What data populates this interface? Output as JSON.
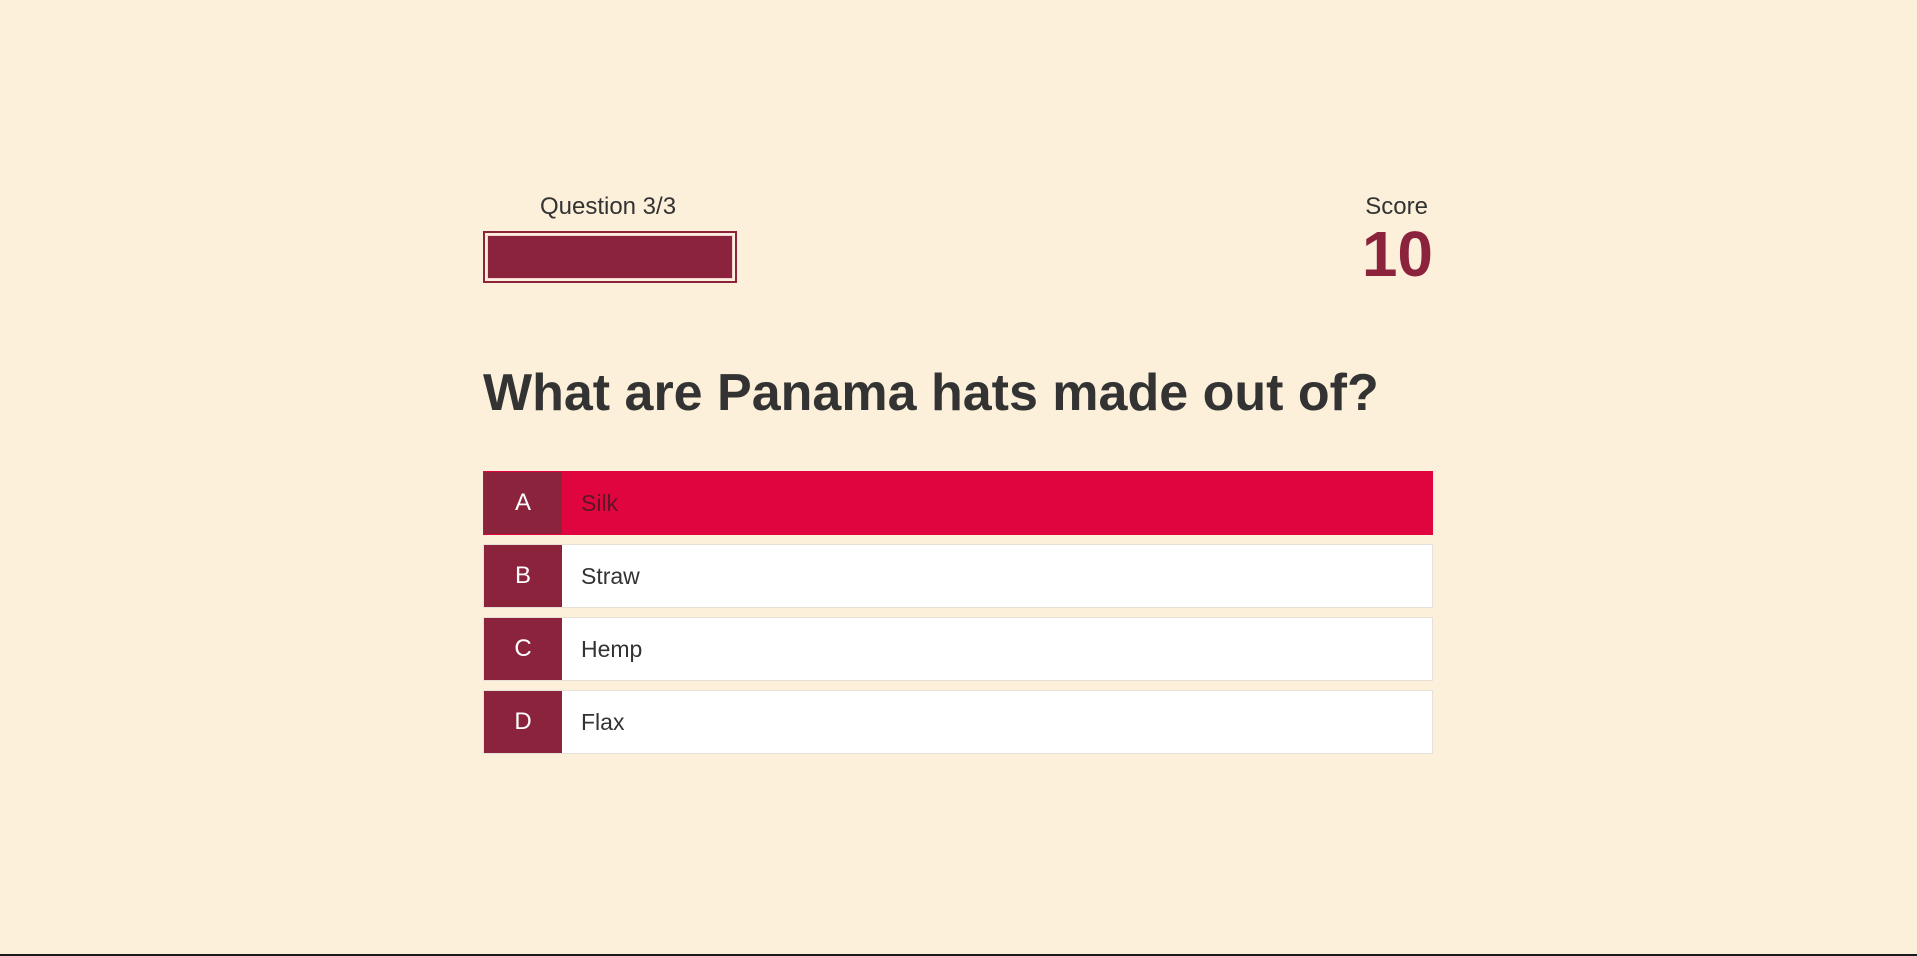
{
  "hud": {
    "question_counter": "Question 3/3",
    "progress": 1.0,
    "score_label": "Score",
    "score_value": "10"
  },
  "question": {
    "text": "What are Panama hats made out of?"
  },
  "choices": [
    {
      "prefix": "A",
      "text": "Silk",
      "selected": true
    },
    {
      "prefix": "B",
      "text": "Straw",
      "selected": false
    },
    {
      "prefix": "C",
      "text": "Hemp",
      "selected": false
    },
    {
      "prefix": "D",
      "text": "Flax",
      "selected": false
    }
  ],
  "colors": {
    "background": "#fdf0da",
    "accent": "#8b233c",
    "selected_incorrect": "#e1053f",
    "text": "#333333"
  }
}
